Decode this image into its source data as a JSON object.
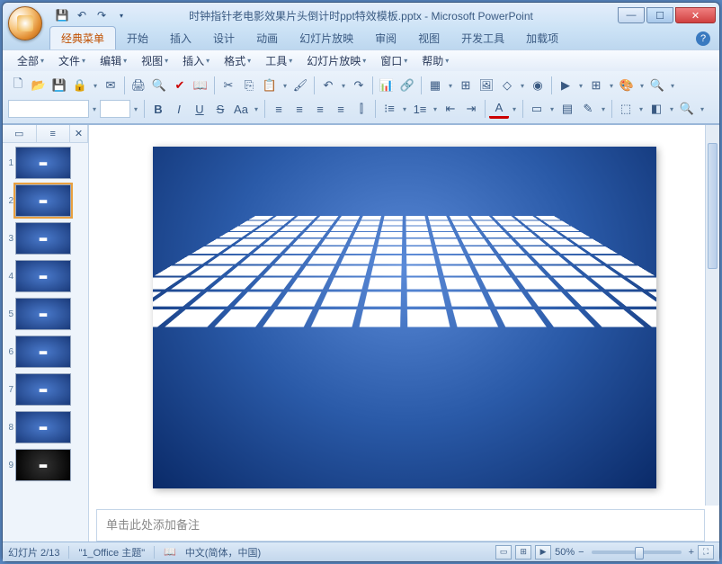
{
  "title": "时钟指针老电影效果片头倒计时ppt特效模板.pptx - Microsoft PowerPoint",
  "ribbon_tabs": [
    "经典菜单",
    "开始",
    "插入",
    "设计",
    "动画",
    "幻灯片放映",
    "审阅",
    "视图",
    "开发工具",
    "加载项"
  ],
  "active_tab": 0,
  "classic_menu": [
    "全部",
    "文件",
    "编辑",
    "视图",
    "插入",
    "格式",
    "工具",
    "幻灯片放映",
    "窗口",
    "帮助"
  ],
  "notes_placeholder": "单击此处添加备注",
  "status": {
    "slide_indicator": "幻灯片 2/13",
    "theme": "\"1_Office 主题\"",
    "language": "中文(简体，中国)",
    "zoom": "50%"
  },
  "thumbs": [
    {
      "n": "1",
      "sel": false,
      "variant": "blue"
    },
    {
      "n": "2",
      "sel": true,
      "variant": "blue"
    },
    {
      "n": "3",
      "sel": false,
      "variant": "blue"
    },
    {
      "n": "4",
      "sel": false,
      "variant": "blue"
    },
    {
      "n": "5",
      "sel": false,
      "variant": "blue"
    },
    {
      "n": "6",
      "sel": false,
      "variant": "blue"
    },
    {
      "n": "7",
      "sel": false,
      "variant": "blue"
    },
    {
      "n": "8",
      "sel": false,
      "variant": "blue"
    },
    {
      "n": "9",
      "sel": false,
      "variant": "dark"
    }
  ],
  "font_size_box": ""
}
